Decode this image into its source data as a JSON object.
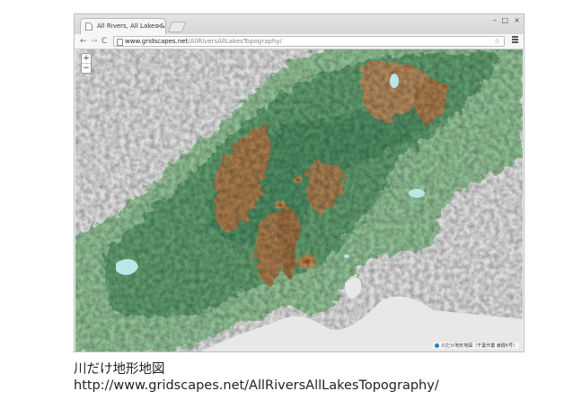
{
  "browser": {
    "tab_title": "All Rivers, All Lakes & T",
    "tab_close": "×",
    "url_domain": "www.gridscapes.net",
    "url_path": "/AllRiversAllLakesTopography/",
    "window_controls": {
      "minimize": "–",
      "maximize": "□",
      "close": "×"
    },
    "nav": {
      "back": "←",
      "forward": "→",
      "reload": "C"
    },
    "star": "☆"
  },
  "map": {
    "zoom_in": "+",
    "zoom_out": "−",
    "attribution": "川だけ地形地図（千葉作業 東経6号）",
    "colors": {
      "lowland": "#d6d9d6",
      "plain": "#8fbf94",
      "forest": "#4e8d63",
      "mountain": "#a67a4c",
      "peak": "#c9905a",
      "water": "#b9e6e6"
    }
  },
  "caption": {
    "line1": "川だけ地形地図",
    "line2": "http://www.gridscapes.net/AllRiversAllLakesTopography/"
  }
}
